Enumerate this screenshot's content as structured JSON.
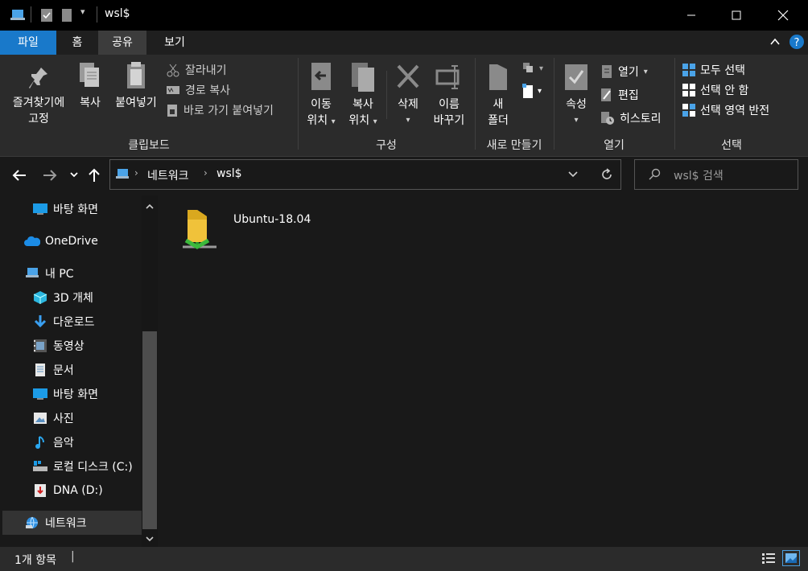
{
  "window": {
    "title": "wsl$"
  },
  "tabs": {
    "file": "파일",
    "home": "홈",
    "share": "공유",
    "view": "보기"
  },
  "ribbon": {
    "clipboard": {
      "label": "클립보드",
      "pin": [
        "즐겨찾기에",
        "고정"
      ],
      "copy": "복사",
      "paste": "붙여넣기",
      "cut": "잘라내기",
      "copy_path": "경로 복사",
      "paste_shortcut": "바로 가기 붙여넣기"
    },
    "organize": {
      "label": "구성",
      "move_to": [
        "이동",
        "위치"
      ],
      "copy_to": [
        "복사",
        "위치"
      ],
      "delete": "삭제",
      "rename": [
        "이름",
        "바꾸기"
      ]
    },
    "new": {
      "label": "새로 만들기",
      "new_folder": [
        "새",
        "폴더"
      ]
    },
    "open": {
      "label": "열기",
      "properties": "속성",
      "open": "열기",
      "edit": "편집",
      "history": "히스토리"
    },
    "select": {
      "label": "선택",
      "select_all": "모두 선택",
      "select_none": "선택 안 함",
      "invert": "선택 영역 반전"
    }
  },
  "address": {
    "crumbs": [
      "네트워크",
      "wsl$"
    ]
  },
  "search": {
    "placeholder": "wsl$ 검색"
  },
  "sidebar": {
    "items": [
      {
        "label": "바탕 화면",
        "icon": "desktop-icon"
      },
      {
        "label": "OneDrive",
        "icon": "cloud-icon"
      },
      {
        "label": "내 PC",
        "icon": "pc-icon"
      },
      {
        "label": "3D 개체",
        "icon": "cube-icon"
      },
      {
        "label": "다운로드",
        "icon": "download-icon"
      },
      {
        "label": "동영상",
        "icon": "video-icon"
      },
      {
        "label": "문서",
        "icon": "document-icon"
      },
      {
        "label": "바탕 화면",
        "icon": "desktop-icon"
      },
      {
        "label": "사진",
        "icon": "picture-icon"
      },
      {
        "label": "음악",
        "icon": "music-icon"
      },
      {
        "label": "로컬 디스크 (C:)",
        "icon": "drive-icon"
      },
      {
        "label": "DNA (D:)",
        "icon": "usb-drive-icon"
      },
      {
        "label": "네트워크",
        "icon": "network-icon"
      }
    ]
  },
  "content": {
    "items": [
      {
        "name": "Ubuntu-18.04",
        "icon": "network-share-folder-icon"
      }
    ]
  },
  "status": {
    "count": "1개 항목"
  },
  "colors": {
    "accent": "#1979ca",
    "background": "#191919",
    "ribbon": "#2b2b2b",
    "selected": "#333333"
  }
}
